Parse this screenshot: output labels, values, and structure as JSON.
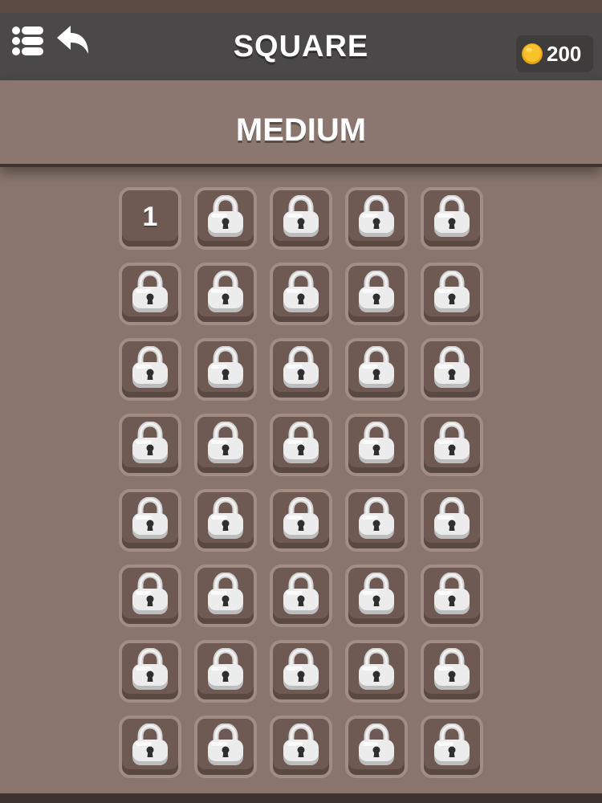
{
  "header": {
    "title": "SQUARE",
    "coins": "200"
  },
  "difficulty": {
    "label": "MEDIUM"
  },
  "levels": {
    "columns": 5,
    "rows_visible": 8,
    "items": [
      {
        "label": "1",
        "locked": false
      },
      {
        "label": "",
        "locked": true
      },
      {
        "label": "",
        "locked": true
      },
      {
        "label": "",
        "locked": true
      },
      {
        "label": "",
        "locked": true
      },
      {
        "label": "",
        "locked": true
      },
      {
        "label": "",
        "locked": true
      },
      {
        "label": "",
        "locked": true
      },
      {
        "label": "",
        "locked": true
      },
      {
        "label": "",
        "locked": true
      },
      {
        "label": "",
        "locked": true
      },
      {
        "label": "",
        "locked": true
      },
      {
        "label": "",
        "locked": true
      },
      {
        "label": "",
        "locked": true
      },
      {
        "label": "",
        "locked": true
      },
      {
        "label": "",
        "locked": true
      },
      {
        "label": "",
        "locked": true
      },
      {
        "label": "",
        "locked": true
      },
      {
        "label": "",
        "locked": true
      },
      {
        "label": "",
        "locked": true
      },
      {
        "label": "",
        "locked": true
      },
      {
        "label": "",
        "locked": true
      },
      {
        "label": "",
        "locked": true
      },
      {
        "label": "",
        "locked": true
      },
      {
        "label": "",
        "locked": true
      },
      {
        "label": "",
        "locked": true
      },
      {
        "label": "",
        "locked": true
      },
      {
        "label": "",
        "locked": true
      },
      {
        "label": "",
        "locked": true
      },
      {
        "label": "",
        "locked": true
      },
      {
        "label": "",
        "locked": true
      },
      {
        "label": "",
        "locked": true
      },
      {
        "label": "",
        "locked": true
      },
      {
        "label": "",
        "locked": true
      },
      {
        "label": "",
        "locked": true
      },
      {
        "label": "",
        "locked": true
      },
      {
        "label": "",
        "locked": true
      },
      {
        "label": "",
        "locked": true
      },
      {
        "label": "",
        "locked": true
      },
      {
        "label": "",
        "locked": true
      }
    ]
  },
  "icons": {
    "menu": "list-menu-icon",
    "back": "back-arrow-icon",
    "coin": "coin-icon",
    "lock": "padlock-icon"
  },
  "colors": {
    "header_bg": "#4a4848",
    "page_bg": "#8a756e",
    "tile_bg": "#6e5a53",
    "tile_border": "#a28c84",
    "coin": "#f5b820"
  }
}
